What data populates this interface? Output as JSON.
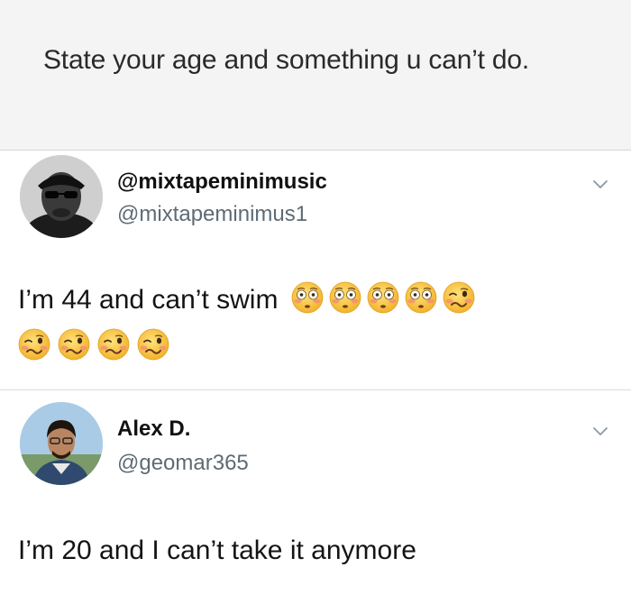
{
  "prompt": {
    "text": "State your age and something u can’t do."
  },
  "tweets": [
    {
      "display_name": "@mixtapeminimusic",
      "handle": "@mixtapeminimus1",
      "text": "I’m 44 and can’t swim",
      "emojis_inline": [
        "flushed-face-emoji",
        "flushed-face-emoji",
        "flushed-face-emoji",
        "flushed-face-emoji",
        "woozy-face-emoji"
      ],
      "emojis_next_line": [
        "woozy-face-emoji",
        "woozy-face-emoji",
        "woozy-face-emoji",
        "woozy-face-emoji"
      ],
      "avatar": "avatar-man-sunglasses-cap"
    },
    {
      "display_name": "Alex D.",
      "handle": "@geomar365",
      "text": "I’m 20 and I can’t take it anymore",
      "avatar": "avatar-man-outdoors"
    }
  ],
  "icons": {
    "chevron": "chevron-down-icon"
  },
  "colors": {
    "prompt_bg": "#f4f4f4",
    "handle_gray": "#5e6b75",
    "emoji_yellow": "#f7c33e"
  }
}
